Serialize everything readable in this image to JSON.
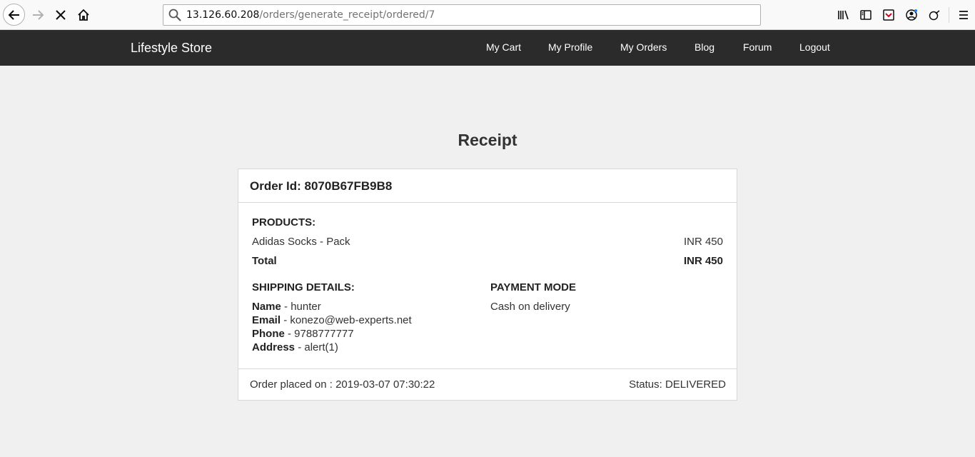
{
  "browser": {
    "url_host": "13.126.60.208",
    "url_path": "/orders/generate_receipt/ordered/7"
  },
  "site": {
    "brand": "Lifestyle Store",
    "nav": [
      {
        "label": "My Cart"
      },
      {
        "label": "My Profile"
      },
      {
        "label": "My Orders"
      },
      {
        "label": "Blog"
      },
      {
        "label": "Forum"
      },
      {
        "label": "Logout"
      }
    ]
  },
  "receipt": {
    "title": "Receipt",
    "order_id_label": "Order Id: 8070B67FB9B8",
    "products_heading": "PRODUCTS:",
    "products": [
      {
        "name": "Adidas Socks - Pack",
        "price": "INR 450"
      }
    ],
    "total_label": "Total",
    "total_value": "INR 450",
    "shipping_heading": "SHIPPING DETAILS:",
    "shipping": {
      "name_label": "Name",
      "name_value": " - hunter",
      "email_label": "Email",
      "email_value": " - konezo@web-experts.net",
      "phone_label": "Phone",
      "phone_value": " - 9788777777",
      "address_label": "Address",
      "address_value": " - alert(1)"
    },
    "payment_heading": "PAYMENT MODE",
    "payment_value": "Cash on delivery",
    "placed_on": "Order placed on : 2019-03-07 07:30:22",
    "status": "Status: DELIVERED"
  }
}
